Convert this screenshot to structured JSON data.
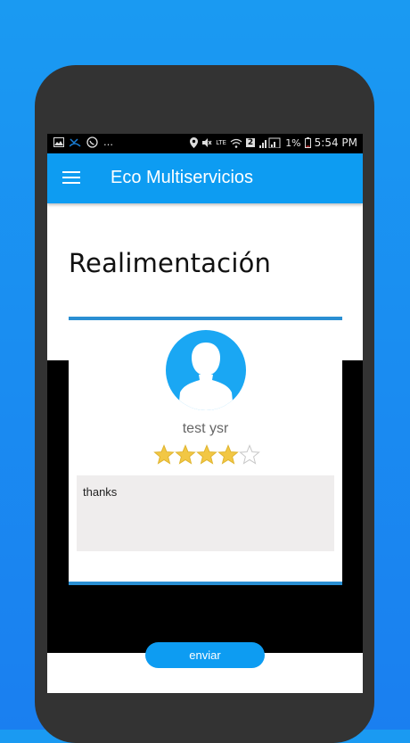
{
  "status_bar": {
    "time": "5:54 PM",
    "battery_percent": "1%",
    "sim_badge": "2",
    "lte_label": "LTE",
    "left_glyph": "…"
  },
  "app_bar": {
    "title": "Eco Multiservicios"
  },
  "page": {
    "title": "Realimentación"
  },
  "feedback_card": {
    "user_name": "test ysr",
    "rating": 4,
    "max_rating": 5,
    "comment": "thanks"
  },
  "actions": {
    "send_label": "enviar"
  },
  "colors": {
    "brand_blue": "#0d9cf2",
    "card_border": "#2a8fd3",
    "star_fill": "#f2c744",
    "comment_bg": "#efeded"
  }
}
